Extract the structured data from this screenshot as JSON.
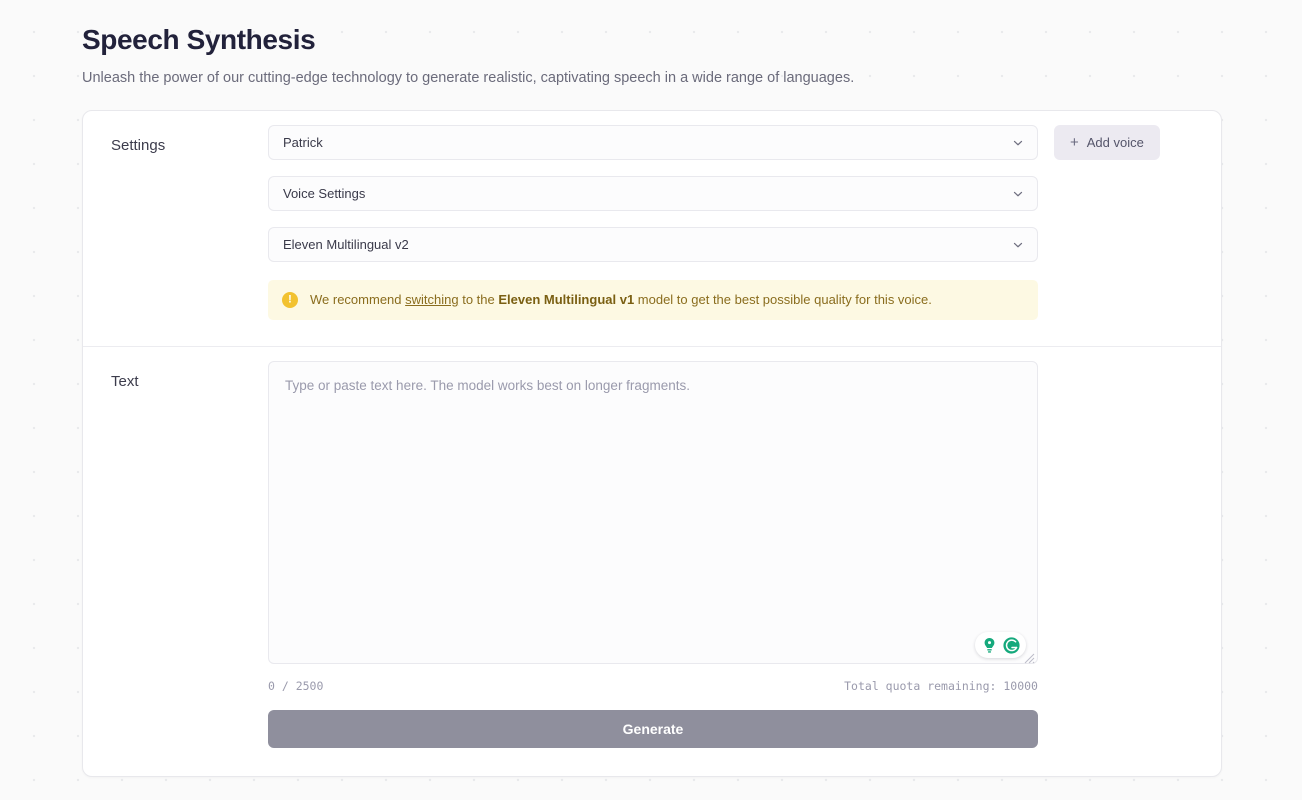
{
  "page": {
    "title": "Speech Synthesis",
    "subtitle": "Unleash the power of our cutting-edge technology to generate realistic, captivating speech in a wide range of languages."
  },
  "settings": {
    "label": "Settings",
    "voice_select": {
      "value": "Patrick",
      "icon": "chevron-down-icon"
    },
    "voice_settings_select": {
      "value": "Voice Settings",
      "icon": "chevron-down-icon"
    },
    "model_select": {
      "value": "Eleven Multilingual v2",
      "icon": "chevron-down-icon"
    },
    "add_voice_button": {
      "label": "Add voice",
      "icon": "plus-icon"
    },
    "warning": {
      "icon": "warning-circle-icon",
      "prefix": "We recommend ",
      "link": "switching",
      "middle": " to the ",
      "strong": "Eleven Multilingual v1",
      "suffix": " model to get the best possible quality for this voice."
    }
  },
  "text_section": {
    "label": "Text",
    "textarea": {
      "placeholder": "Type or paste text here. The model works best on longer fragments.",
      "value": ""
    },
    "grammarly": {
      "bulb_icon": "lightbulb-icon",
      "logo_icon": "grammarly-logo-icon"
    },
    "char_counter": "0 / 2500",
    "quota_text": "Total quota remaining: 10000",
    "generate_button": "Generate"
  },
  "colors": {
    "accent_warning_bg": "#fdf9e3",
    "accent_warning_icon": "#f2c230",
    "warning_text": "#8a6d1e",
    "generate_bg": "#8f8f9d",
    "add_voice_bg": "#eceaf1",
    "grammarly_green": "#15a97c",
    "page_bg": "#fafafa"
  }
}
